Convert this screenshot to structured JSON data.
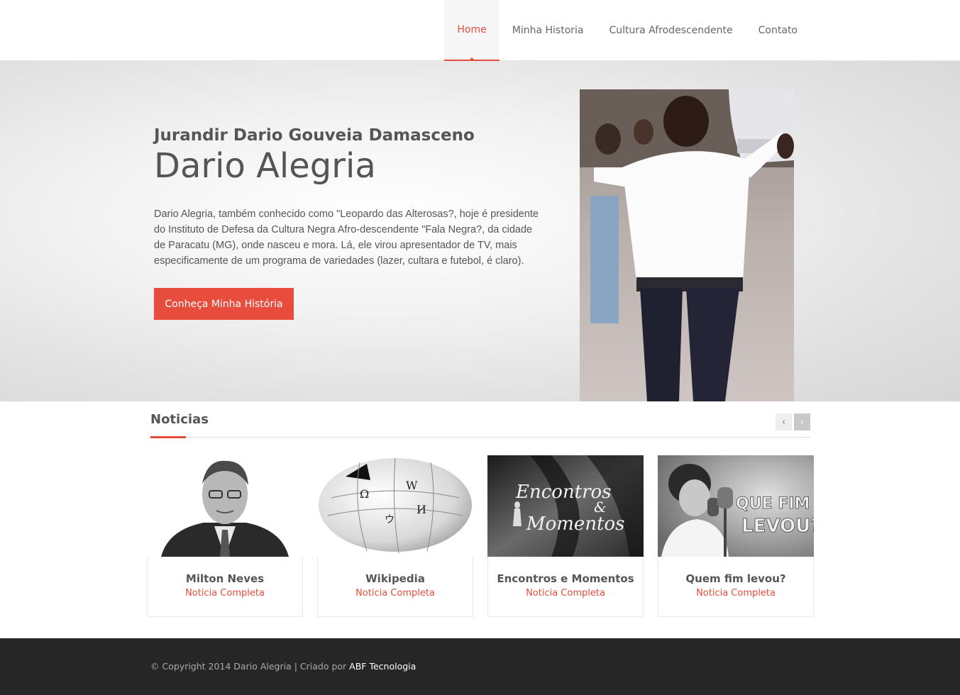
{
  "nav": {
    "items": [
      {
        "label": "Home"
      },
      {
        "label": "Minha Historia"
      },
      {
        "label": "Cultura Afrodescendente"
      },
      {
        "label": "Contato"
      }
    ]
  },
  "hero": {
    "subtitle": "Jurandir Dario Gouveia Damasceno",
    "title": "Dario Alegria",
    "text": "Dario Alegria, também conhecido como \"Leopardo das Alterosas?, hoje é presidente do Instituto de Defesa da Cultura Negra Afro-descendente \"Fala Negra?, da cidade de Paracatu (MG), onde nasceu e mora. Lá, ele virou apresentador de TV, mais especificamente de um programa de variedades (lazer, cultara e futebol, é claro).",
    "button": "Conheça Minha História"
  },
  "news": {
    "title": "Noticias",
    "prev": "‹",
    "next": "›",
    "cards": [
      {
        "title": "Milton Neves",
        "link": "Noticia Completa"
      },
      {
        "title": "Wikipedia",
        "link": "Noticia Completa"
      },
      {
        "title": "Encontros e Momentos",
        "link": "Noticia Completa",
        "image_text": [
          "Encontros",
          "&",
          "Momentos"
        ]
      },
      {
        "title": "Quem fim levou?",
        "link": "Noticia Completa",
        "image_text": [
          "QUE FIM",
          "LEVOU?"
        ]
      }
    ]
  },
  "footer": {
    "copyright": "© Copyright 2014 Dario Alegria | Criado por ",
    "credit": "ABF Tecnologia"
  },
  "colors": {
    "accent": "#e74c3c",
    "footer_bg": "#262626"
  }
}
